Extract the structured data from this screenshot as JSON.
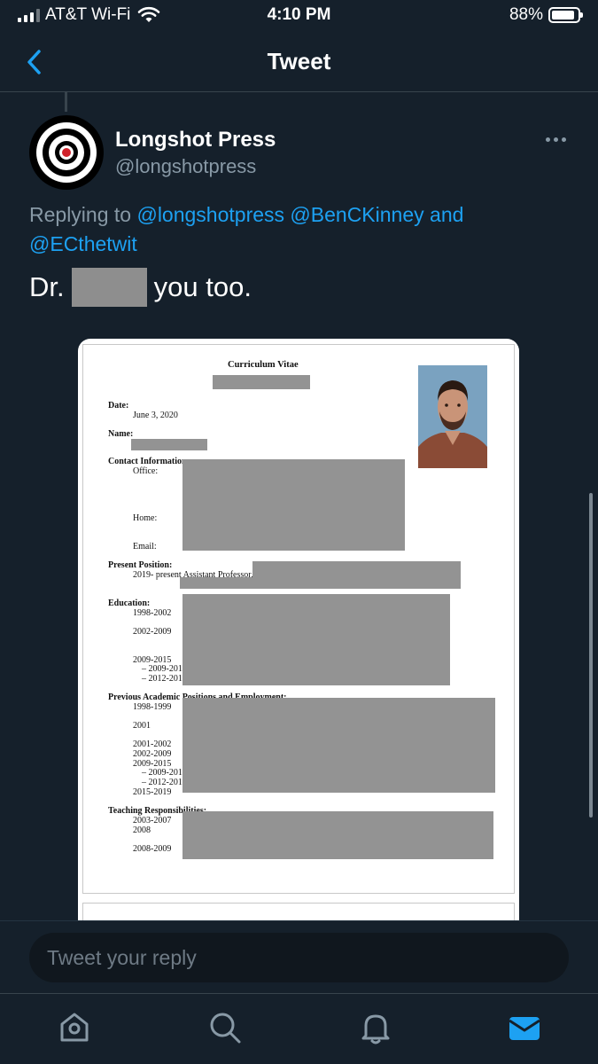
{
  "status_bar": {
    "carrier": "AT&T Wi-Fi",
    "time": "4:10 PM",
    "battery": "88%",
    "battery_level": 0.88
  },
  "nav": {
    "title": "Tweet",
    "back_icon": "chevron-left-icon"
  },
  "tweet": {
    "author_name": "Longshot Press",
    "author_handle": "@longshotpress",
    "replying_prefix": "Replying to",
    "mention_1": "@longshotpress",
    "mention_2": "@BenCKinney",
    "replying_and": "and",
    "mention_3": "@ECthetwit",
    "text_before": "Dr.",
    "text_after": "you too."
  },
  "cv_document": {
    "title": "Curriculum Vitae",
    "date_label": "Date:",
    "date_value": "June 3, 2020",
    "name_label": "Name:",
    "contact_label": "Contact Information:",
    "office_label": "Office:",
    "home_label": "Home:",
    "email_label": "Email:",
    "present_label": "Present Position:",
    "present_value": "2019- present  Assistant Professor,",
    "education_label": "Education:",
    "education_years": [
      "1998-2002",
      "2002-2009",
      "2009-2015",
      "– 2009-201",
      "– 2012-201"
    ],
    "previous_label": "Previous Academic Positions and Employment:",
    "previous_years": [
      "1998-1999",
      "2001",
      "2001-2002",
      "2002-2009",
      "2009-2015",
      "– 2009-201",
      "– 2012-201",
      "2015-2019"
    ],
    "teaching_label": "Teaching Responsibilities:",
    "teaching_years": [
      "2003-2007",
      "2008",
      "2008-2009"
    ]
  },
  "reply": {
    "placeholder": "Tweet your reply"
  },
  "tabs": [
    "home-icon",
    "search-icon",
    "notifications-icon",
    "messages-icon"
  ],
  "colors": {
    "background": "#15202b",
    "accent": "#1da1f2",
    "secondary_text": "#8899a6"
  }
}
